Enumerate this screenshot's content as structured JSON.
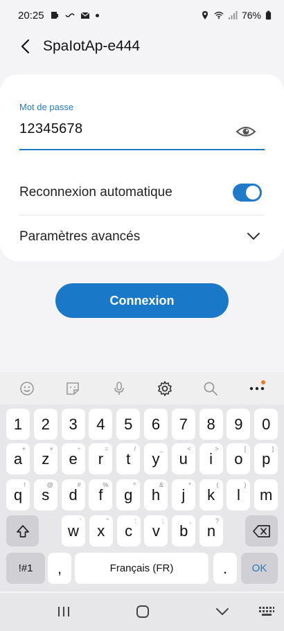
{
  "status": {
    "time": "20:25",
    "battery": "76%"
  },
  "header": {
    "title": "SpaIotAp-e444"
  },
  "password": {
    "label": "Mot de passe",
    "value": "12345678"
  },
  "auto_reconnect": {
    "label": "Reconnexion automatique",
    "enabled": true
  },
  "advanced": {
    "label": "Paramètres avancés"
  },
  "connect_button": {
    "label": "Connexion"
  },
  "keyboard": {
    "row_numbers": [
      "1",
      "2",
      "3",
      "4",
      "5",
      "6",
      "7",
      "8",
      "9",
      "0"
    ],
    "row1": [
      {
        "k": "a",
        "s": "+"
      },
      {
        "k": "z",
        "s": "×"
      },
      {
        "k": "e",
        "s": "÷"
      },
      {
        "k": "r",
        "s": "="
      },
      {
        "k": "t",
        "s": "/"
      },
      {
        "k": "y",
        "s": "_"
      },
      {
        "k": "u",
        "s": "<"
      },
      {
        "k": "i",
        "s": ">"
      },
      {
        "k": "o",
        "s": "["
      },
      {
        "k": "p",
        "s": "]"
      }
    ],
    "row2": [
      {
        "k": "q",
        "s": "!"
      },
      {
        "k": "s",
        "s": "@"
      },
      {
        "k": "d",
        "s": "#"
      },
      {
        "k": "f",
        "s": "%"
      },
      {
        "k": "g",
        "s": "^"
      },
      {
        "k": "h",
        "s": "&"
      },
      {
        "k": "j",
        "s": "*"
      },
      {
        "k": "k",
        "s": "("
      },
      {
        "k": "l",
        "s": ")"
      },
      {
        "k": "m",
        "s": ""
      }
    ],
    "row3": [
      {
        "k": "w",
        "s": "'"
      },
      {
        "k": "x",
        "s": "\""
      },
      {
        "k": "c",
        "s": ":"
      },
      {
        "k": "v",
        "s": ";"
      },
      {
        "k": "b",
        "s": ","
      },
      {
        "k": "n",
        "s": "?"
      }
    ],
    "sym_key": "!#1",
    "comma_key": ",",
    "space_label": "Français (FR)",
    "period_key": ".",
    "ok_key": "OK"
  }
}
